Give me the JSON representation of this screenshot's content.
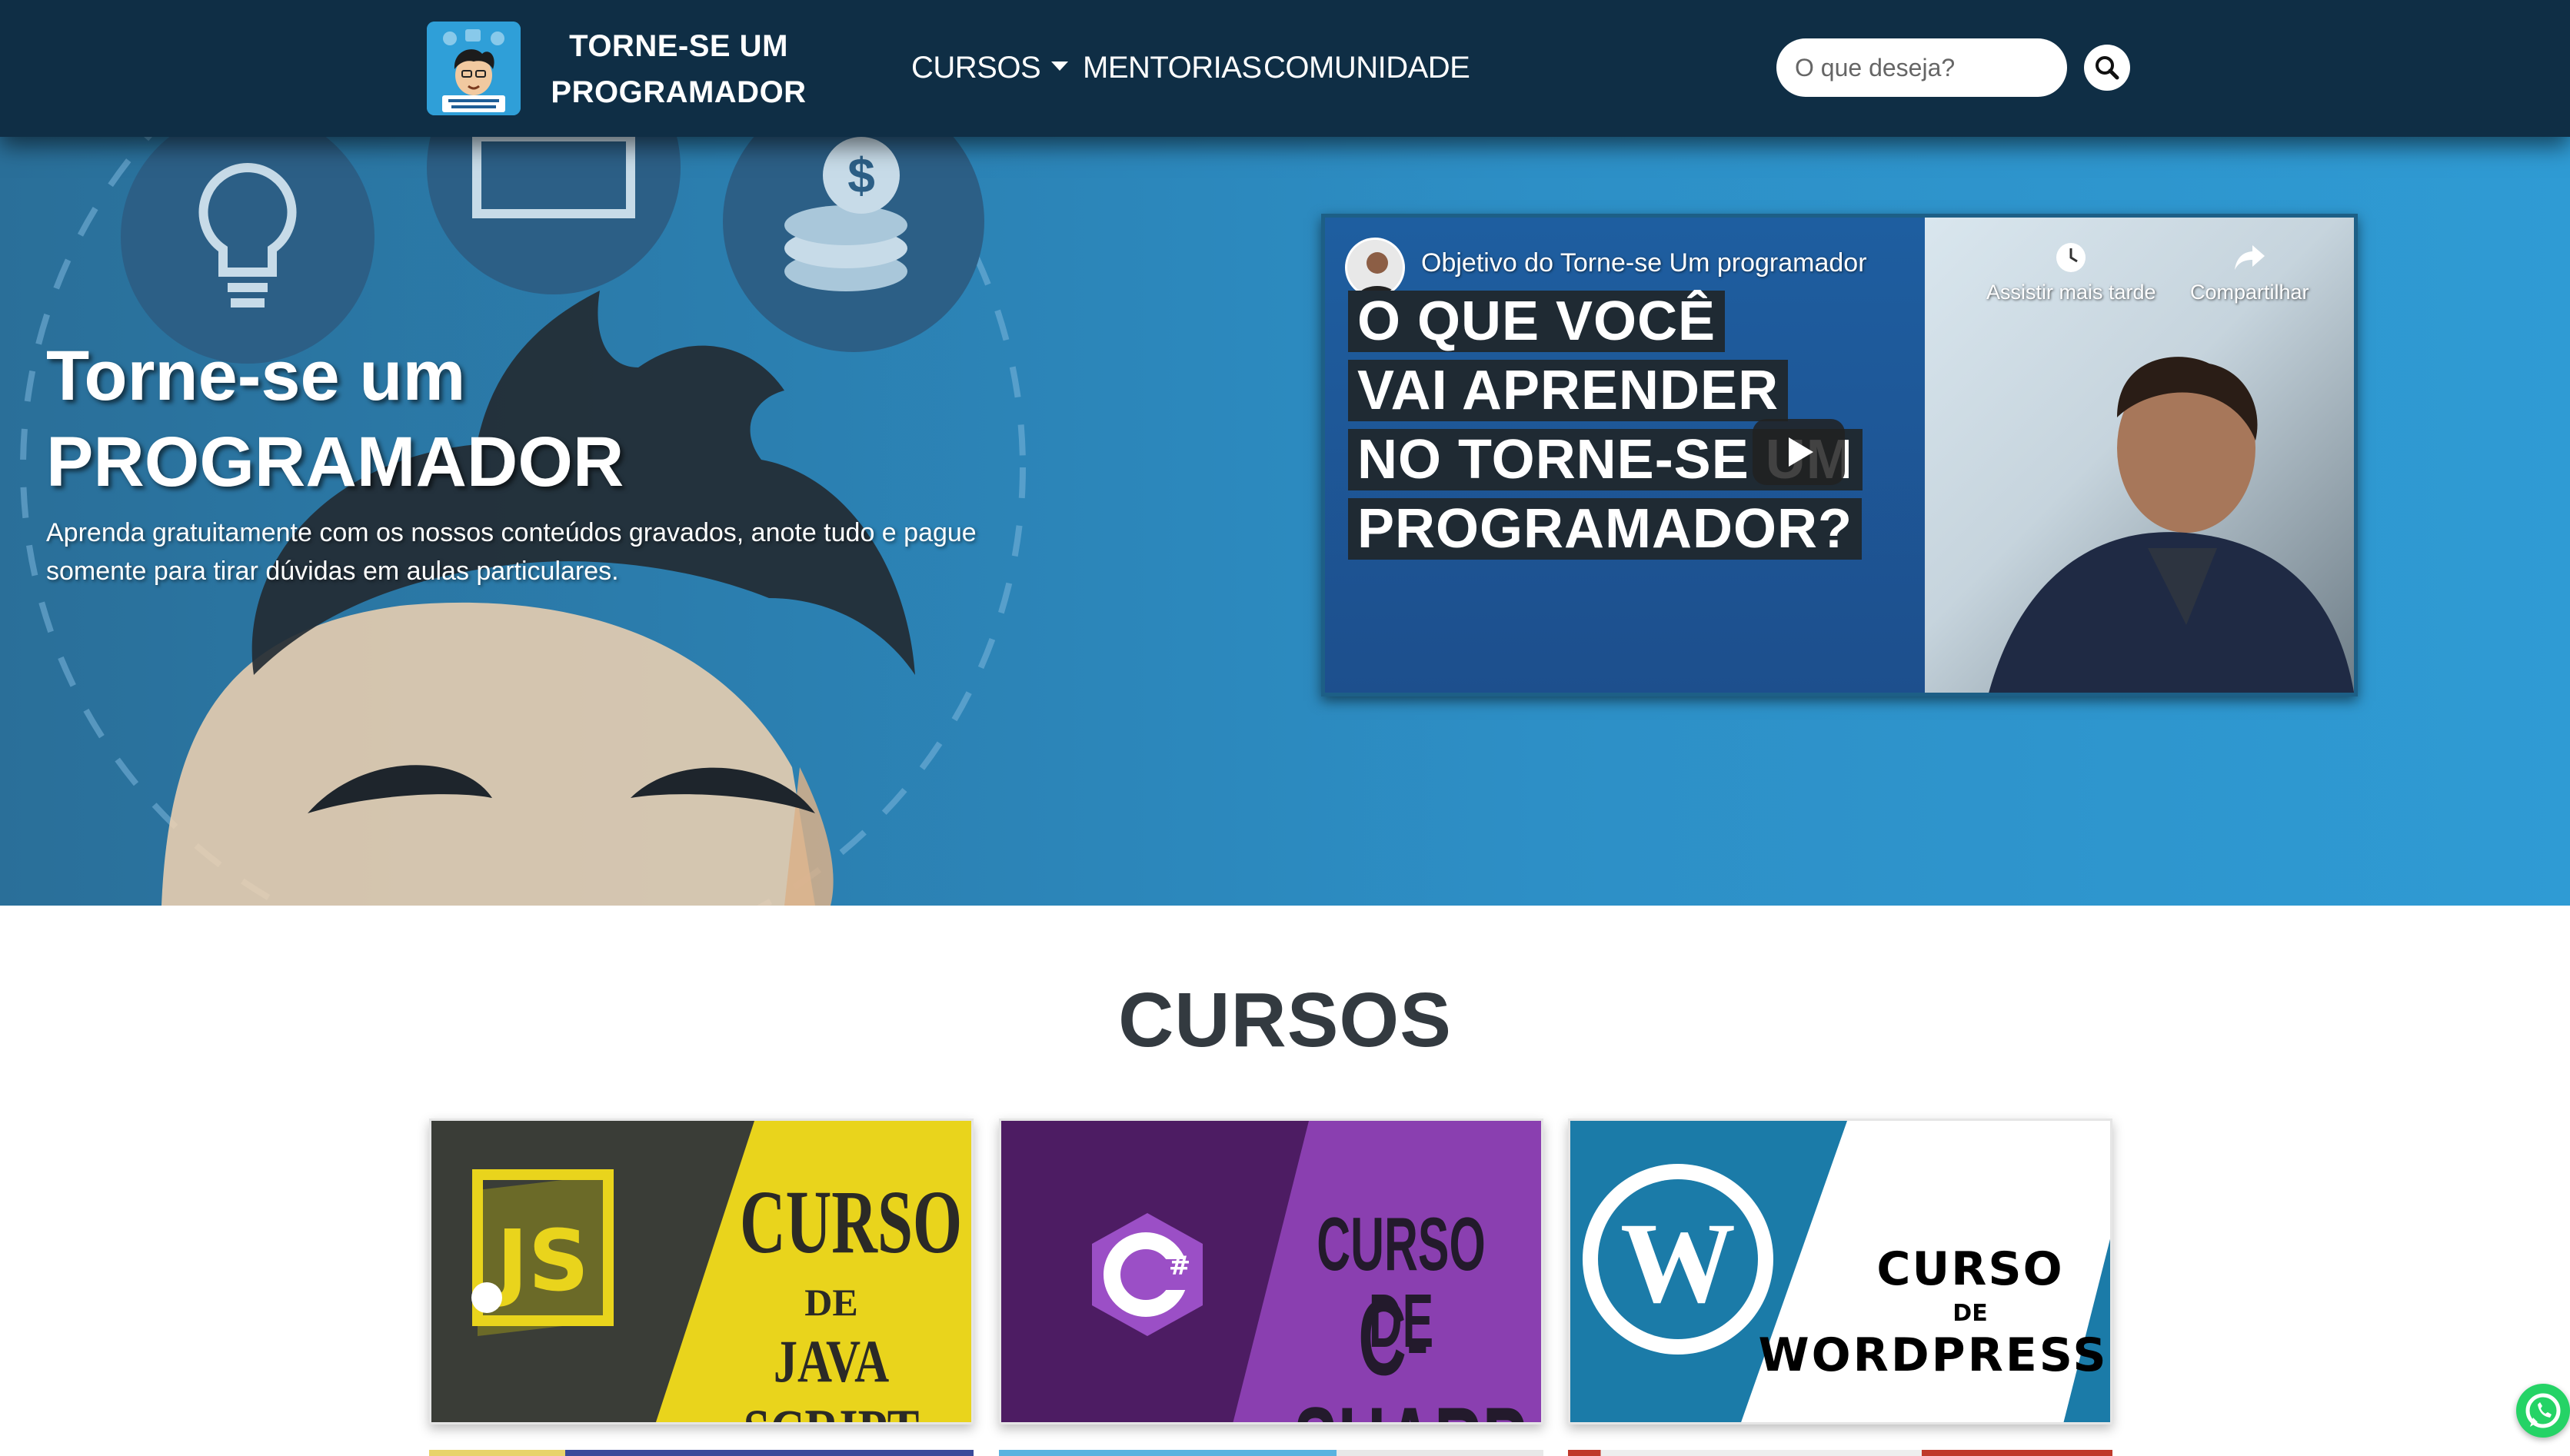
{
  "nav": {
    "brand": "TORNE-SE UM PROGRAMADOR",
    "logo_alt_icon": "programmer-avatar-logo",
    "links": [
      {
        "label": "CURSOS",
        "has_dropdown": true
      },
      {
        "label": "MENTORIAS"
      },
      {
        "label": "COMUNIDADE"
      }
    ],
    "search": {
      "placeholder": "O que deseja?",
      "button_icon": "search-icon"
    }
  },
  "hero": {
    "title_line1": "Torne-se um",
    "title_line2": "PROGRAMADOR",
    "subtitle": "Aprenda gratuitamente com os nossos conteúdos gravados, anote tudo e pague somente para tirar dúvidas em aulas particulares.",
    "video": {
      "title": "Objetivo do Torne-se Um programador",
      "thumbnail_lines": [
        "O QUE VOCÊ",
        "VAI APRENDER",
        "NO TORNE-SE UM",
        "PROGRAMADOR?"
      ],
      "watch_later": "Assistir mais tarde",
      "share": "Compartilhar"
    }
  },
  "courses": {
    "title": "CURSOS",
    "cards": [
      {
        "line1": "CURSO",
        "line2": "DE",
        "line3": "JAVA SCRIPT",
        "logo": "JS",
        "color": "#e9d41c"
      },
      {
        "line1": "CURSO DE",
        "line2": "C-SHARP",
        "logo": "C#",
        "color": "#8a3fb0"
      },
      {
        "line1": "CURSO",
        "line2": "DE",
        "line3": "WORDPRESS",
        "logo": "W",
        "color": "#1b7ba8"
      }
    ]
  },
  "floating": {
    "whatsapp_icon": "whatsapp-icon"
  }
}
